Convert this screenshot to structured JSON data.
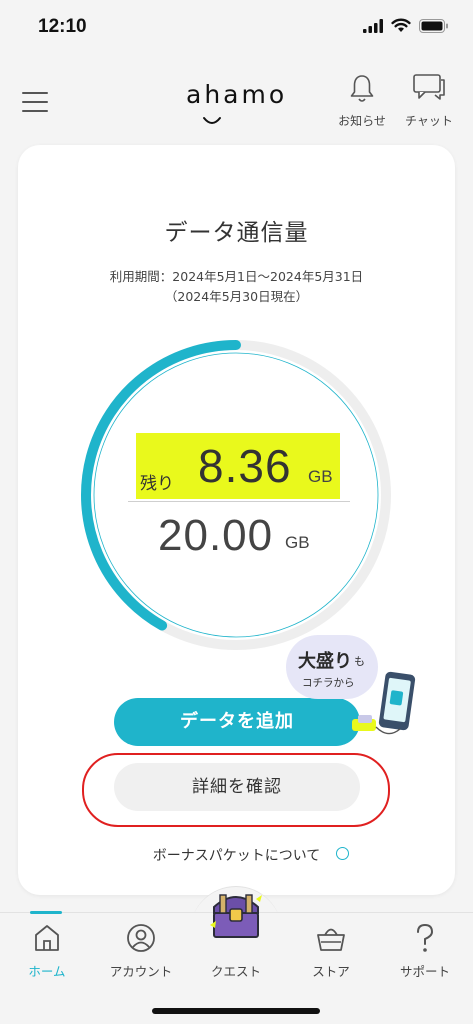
{
  "status": {
    "time": "12:10"
  },
  "header": {
    "logo": "ahamo",
    "notice_label": "お知らせ",
    "chat_label": "チャット"
  },
  "usage": {
    "title": "データ通信量",
    "period": "利用期間：2024年5月1日〜2024年5月31日",
    "as_of": "（2024年5月30日現在）",
    "remaining_label": "残り",
    "remaining_value": "8.36",
    "remaining_unit": "GB",
    "total_value": "20.00",
    "total_unit": "GB",
    "remaining_fraction": 0.418
  },
  "promo": {
    "main": "大盛り",
    "suffix": "も",
    "sub": "コチラから"
  },
  "actions": {
    "add_data": "データを追加",
    "details": "詳細を確認",
    "bonus_link": "ボーナスパケットについて"
  },
  "tabs": [
    {
      "label": "ホーム",
      "icon": "home-icon",
      "active": true
    },
    {
      "label": "アカウント",
      "icon": "person-icon",
      "active": false
    },
    {
      "label": "クエスト",
      "icon": "treasure-chest-icon",
      "active": false
    },
    {
      "label": "ストア",
      "icon": "basket-icon",
      "active": false
    },
    {
      "label": "サポート",
      "icon": "question-icon",
      "active": false
    }
  ],
  "colors": {
    "accent": "#1fb4cb",
    "highlight": "#e9f91c",
    "annotation": "#e02020"
  }
}
